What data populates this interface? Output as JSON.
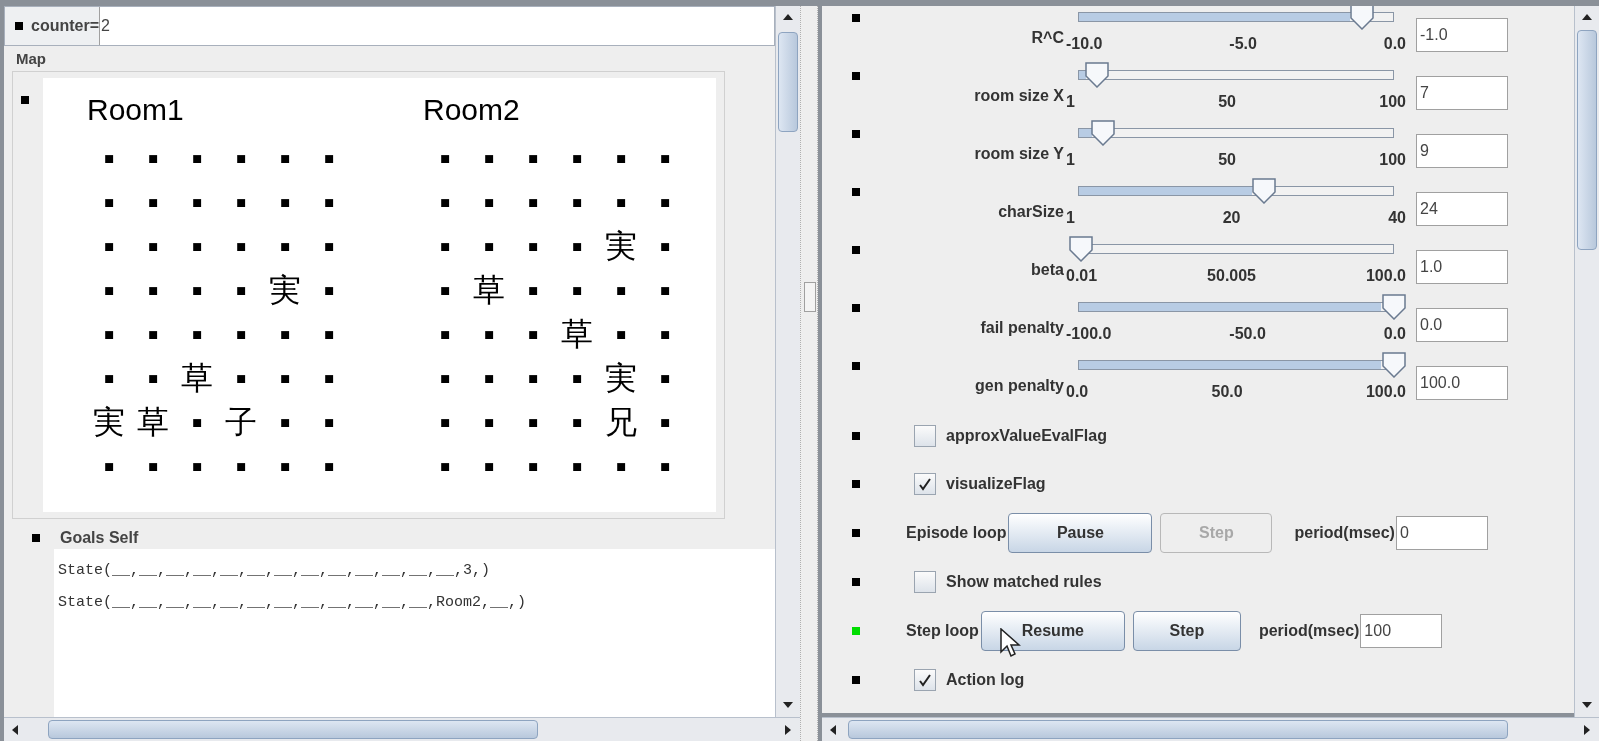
{
  "counter": {
    "label": "counter=",
    "value": "2"
  },
  "map": {
    "title": "Map",
    "rooms": [
      {
        "name": "Room1",
        "rows": [
          [
            "▪",
            "▪",
            "▪",
            "▪",
            "▪",
            "▪"
          ],
          [
            "▪",
            "▪",
            "▪",
            "▪",
            "▪",
            "▪"
          ],
          [
            "▪",
            "▪",
            "▪",
            "▪",
            "▪",
            "▪"
          ],
          [
            "▪",
            "▪",
            "▪",
            "▪",
            "実",
            "▪"
          ],
          [
            "▪",
            "▪",
            "▪",
            "▪",
            "▪",
            "▪"
          ],
          [
            "▪",
            "▪",
            "草",
            "▪",
            "▪",
            "▪"
          ],
          [
            "実",
            "草",
            "▪",
            "子",
            "▪",
            "▪"
          ],
          [
            "▪",
            "▪",
            "▪",
            "▪",
            "▪",
            "▪"
          ]
        ]
      },
      {
        "name": "Room2",
        "rows": [
          [
            "▪",
            "▪",
            "▪",
            "▪",
            "▪",
            "▪"
          ],
          [
            "▪",
            "▪",
            "▪",
            "▪",
            "▪",
            "▪"
          ],
          [
            "▪",
            "▪",
            "▪",
            "▪",
            "実",
            "▪"
          ],
          [
            "▪",
            "草",
            "▪",
            "▪",
            "▪",
            "▪"
          ],
          [
            "▪",
            "▪",
            "▪",
            "草",
            "▪",
            "▪"
          ],
          [
            "▪",
            "▪",
            "▪",
            "▪",
            "実",
            "▪"
          ],
          [
            "▪",
            "▪",
            "▪",
            "▪",
            "兄",
            "▪"
          ],
          [
            "▪",
            "▪",
            "▪",
            "▪",
            "▪",
            "▪"
          ]
        ]
      }
    ]
  },
  "goals": {
    "title": "Goals Self",
    "lines": [
      "State(__,__,__,__,__,__,__,__,__,__,__,__,__,3,)",
      "State(__,__,__,__,__,__,__,__,__,__,__,__,Room2,__,)"
    ]
  },
  "controls": [
    {
      "kind": "slider",
      "label": "R^C",
      "ticks": [
        "-10.0",
        "-5.0",
        "0.0"
      ],
      "level": 0.9,
      "value": "-1.0",
      "color": "#000000"
    },
    {
      "kind": "slider",
      "label": "room size X",
      "ticks": [
        "1",
        "50",
        "100"
      ],
      "level": 0.06,
      "value": "7",
      "color": "#000000"
    },
    {
      "kind": "slider",
      "label": "room size Y",
      "ticks": [
        "1",
        "50",
        "100"
      ],
      "level": 0.08,
      "value": "9",
      "color": "#000000"
    },
    {
      "kind": "slider",
      "label": "charSize",
      "ticks": [
        "1",
        "20",
        "40"
      ],
      "level": 0.59,
      "value": "24",
      "color": "#000000"
    },
    {
      "kind": "slider",
      "label": "beta",
      "ticks": [
        "0.01",
        "50.005",
        "100.0"
      ],
      "level": 0.01,
      "value": "1.0",
      "color": "#000000"
    },
    {
      "kind": "slider",
      "label": "fail penalty",
      "ticks": [
        "-100.0",
        "-50.0",
        "0.0"
      ],
      "level": 1.0,
      "value": "0.0",
      "color": "#000000"
    },
    {
      "kind": "slider",
      "label": "gen penalty",
      "ticks": [
        "0.0",
        "50.0",
        "100.0"
      ],
      "level": 1.0,
      "value": "100.0",
      "color": "#000000"
    },
    {
      "kind": "checkbox",
      "label": "approxValueEvalFlag",
      "checked": false,
      "color": "#000000"
    },
    {
      "kind": "checkbox",
      "label": "visualizeFlag",
      "checked": true,
      "color": "#000000"
    },
    {
      "kind": "loop",
      "label": "Episode loop",
      "buttons": [
        {
          "label": "Pause",
          "disabled": false
        },
        {
          "label": "Step",
          "disabled": true
        }
      ],
      "period_label": "period(msec)",
      "period": "0",
      "color": "#000000"
    },
    {
      "kind": "checkbox",
      "label": "Show matched rules",
      "checked": false,
      "color": "#000000"
    },
    {
      "kind": "loop",
      "label": "Step loop",
      "buttons": [
        {
          "label": "Resume",
          "disabled": false
        },
        {
          "label": "Step",
          "disabled": false
        }
      ],
      "period_label": "period(msec)",
      "period": "100",
      "color": "#00dd00"
    },
    {
      "kind": "checkbox",
      "label": "Action log",
      "checked": true,
      "color": "#000000"
    }
  ]
}
